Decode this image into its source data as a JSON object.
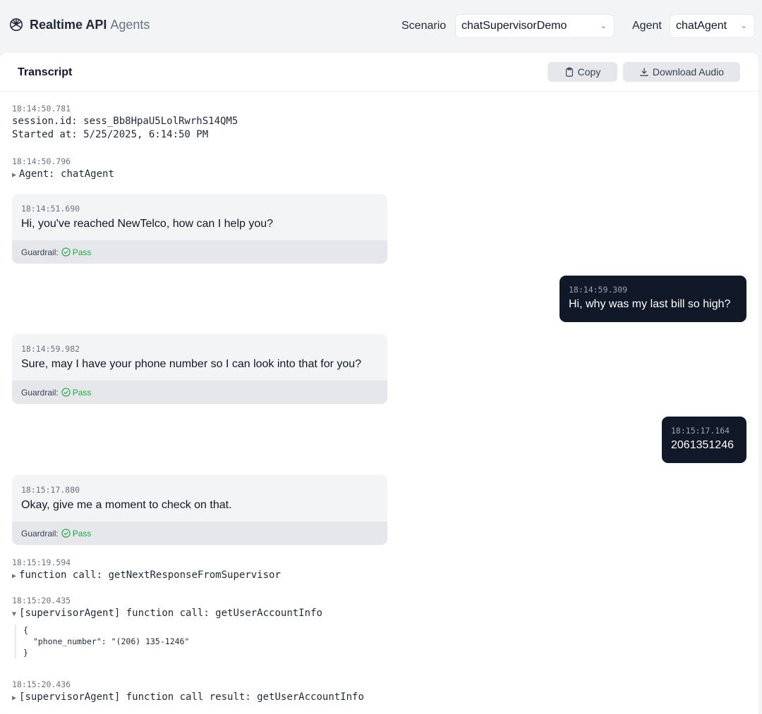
{
  "header": {
    "brand": "Realtime API",
    "brand_sub": "Agents",
    "scenario_label": "Scenario",
    "scenario_value": "chatSupervisorDemo",
    "agent_label": "Agent",
    "agent_value": "chatAgent"
  },
  "transcript": {
    "title": "Transcript",
    "copy_label": "Copy",
    "download_label": "Download Audio"
  },
  "events": [
    {
      "ts": "18:14:50.781",
      "line1": "session.id: sess_Bb8HpaU5LolRwrhS14QM5",
      "line2": "Started at: 5/25/2025, 6:14:50 PM"
    },
    {
      "ts": "18:14:50.796",
      "line1": "Agent: chatAgent"
    }
  ],
  "messages": [
    {
      "ts": "18:14:51.690",
      "text": "Hi, you've reached NewTelco, how can I help you?",
      "guardrail_label": "Guardrail:",
      "guardrail_status": "Pass"
    },
    {
      "ts": "18:14:59.309",
      "text": "Hi, why was my last bill so high?"
    },
    {
      "ts": "18:14:59.982",
      "text": "Sure, may I have your phone number so I can look into that for you?",
      "guardrail_label": "Guardrail:",
      "guardrail_status": "Pass"
    },
    {
      "ts": "18:15:17.164",
      "text": "2061351246"
    },
    {
      "ts": "18:15:17.880",
      "text": "Okay, give me a moment to check on that.",
      "guardrail_label": "Guardrail:",
      "guardrail_status": "Pass"
    }
  ],
  "calls": [
    {
      "ts": "18:15:19.594",
      "text": "function call: getNextResponseFromSupervisor"
    },
    {
      "ts": "18:15:20.435",
      "text": "[supervisorAgent] function call: getUserAccountInfo",
      "json": "{\n  \"phone_number\": \"(206) 135-1246\"\n}"
    },
    {
      "ts": "18:15:20.436",
      "text": "[supervisorAgent] function call result: getUserAccountInfo"
    }
  ]
}
